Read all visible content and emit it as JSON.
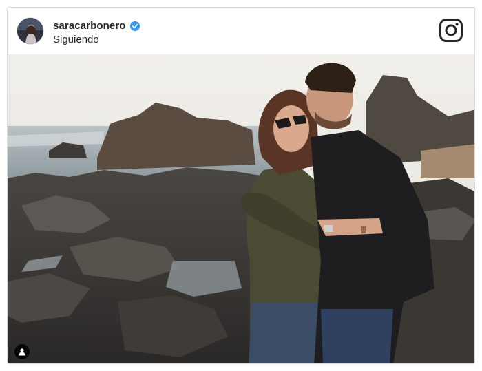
{
  "post": {
    "username": "saracarbonero",
    "subtitle": "Siguiendo",
    "verified": true
  },
  "icons": {
    "avatar": "profile-avatar",
    "verified": "verified-badge-icon",
    "brand": "instagram-icon",
    "tag": "user-tag-icon"
  },
  "colors": {
    "text": "#262626",
    "verified_blue": "#3897f0",
    "border": "#dbdbdb"
  }
}
